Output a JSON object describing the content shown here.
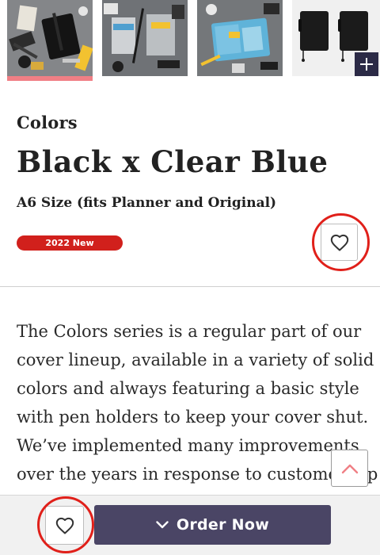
{
  "gallery": {
    "thumbnails": [
      {
        "name": "flatlay-black-cover",
        "active": true
      },
      {
        "name": "flatlay-clear-blue-cover",
        "active": false
      },
      {
        "name": "flatlay-blue-pockets",
        "active": false
      },
      {
        "name": "black-covers-product",
        "active": false
      }
    ],
    "more_icon": "plus-icon"
  },
  "product": {
    "series": "Colors",
    "title": "Black x Clear Blue",
    "size": "A6 Size (fits Planner and Original)",
    "badge": "2022 New"
  },
  "description": {
    "lines": [
      "The Colors series is a regular part of our",
      "cover lineup, available in a variety of solid",
      "colors and always featuring a basic style",
      "with pen holders to keep your cover shut.",
      "We’ve implemented many improvements",
      "over the years in response to customer inp"
    ]
  },
  "actions": {
    "favorite_icon": "heart-outline-icon",
    "scroll_top_icon": "chevron-up-icon",
    "order_icon": "chevron-down-icon",
    "order_label": "Order Now"
  },
  "colors": {
    "active_indicator": "#f07f85",
    "badge": "#d1201c",
    "highlight_ring": "#e0201a",
    "order_button": "#4a4565",
    "plus_button": "#2b2a46"
  }
}
